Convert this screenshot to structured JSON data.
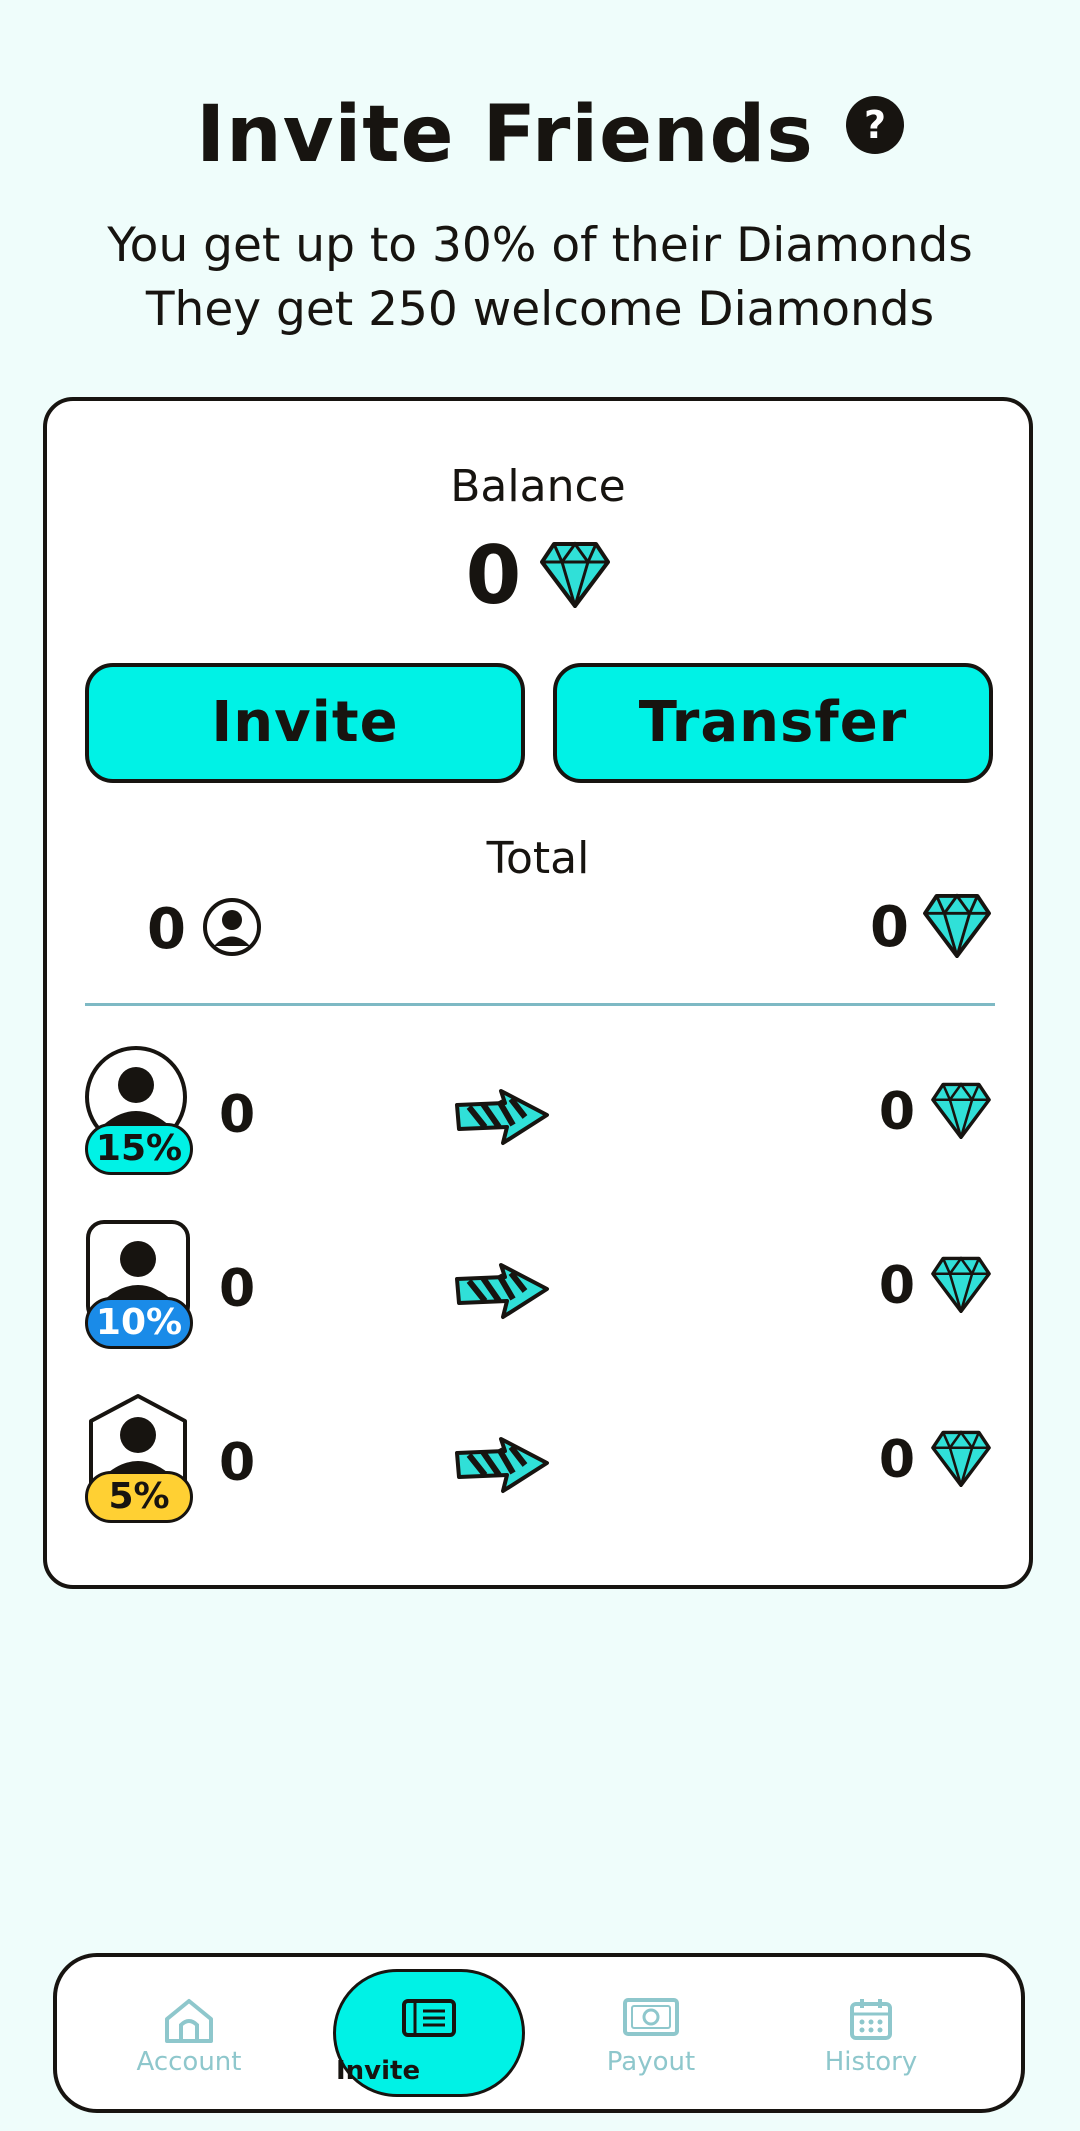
{
  "header": {
    "title": "Invite Friends",
    "help_icon": "?",
    "subtitle_line1": "You get up to 30% of their Diamonds",
    "subtitle_line2": "They get 250 welcome Diamonds"
  },
  "card": {
    "balance_label": "Balance",
    "balance_value": "0",
    "invite_label": "Invite",
    "transfer_label": "Transfer",
    "total_label": "Total",
    "total_friends": "0",
    "total_diamonds": "0",
    "tiers": [
      {
        "percent": "15%",
        "friends": "0",
        "diamonds": "0",
        "badge_color": "#00f2e6"
      },
      {
        "percent": "10%",
        "friends": "0",
        "diamonds": "0",
        "badge_color": "#1a8be8"
      },
      {
        "percent": "5%",
        "friends": "0",
        "diamonds": "0",
        "badge_color": "#ffd033"
      }
    ]
  },
  "nav": {
    "items": [
      {
        "label": "Account",
        "icon": "home-icon"
      },
      {
        "label": "Invite",
        "icon": "ticket-icon"
      },
      {
        "label": "Payout",
        "icon": "money-icon"
      },
      {
        "label": "History",
        "icon": "calendar-icon"
      }
    ]
  },
  "colors": {
    "accent": "#00f2e6",
    "background": "#effdfb",
    "ink": "#171410",
    "inactive": "#8ec7cc"
  }
}
